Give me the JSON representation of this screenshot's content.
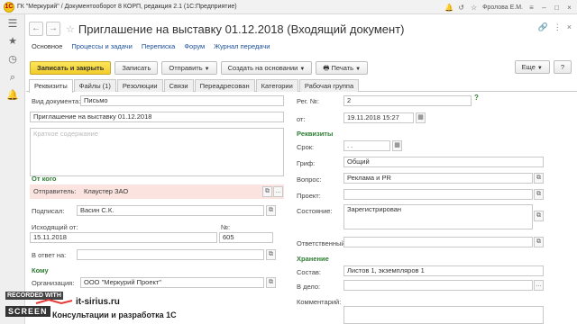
{
  "window": {
    "title": "ГК \"Меркурий\" / Документооборот 8 КОРП, редакция 2.1  (1С:Предприятие)",
    "user": "Фролова Е.М."
  },
  "form": {
    "title": "Приглашение на выставку 01.12.2018 (Входящий документ)"
  },
  "navlinks": {
    "main": "Основное",
    "processes": "Процессы и задачи",
    "correspondence": "Переписка",
    "forum": "Форум",
    "journal": "Журнал передачи"
  },
  "toolbar": {
    "save_close": "Записать и закрыть",
    "save": "Записать",
    "send": "Отправить",
    "create_based": "Создать на основании",
    "print": "Печать",
    "more": "Еще",
    "help": "?"
  },
  "tabs": [
    "Реквизиты",
    "Файлы (1)",
    "Резолюции",
    "Связи",
    "Переадресован",
    "Категории",
    "Рабочая группа"
  ],
  "left": {
    "doc_type_label": "Вид документа:",
    "doc_type": "Письмо",
    "title_label": "Заголовок:",
    "title": "Приглашение на выставку 01.12.2018",
    "summary_placeholder": "Краткое содержание",
    "from_section": "От кого",
    "sender_label": "Отправитель:",
    "sender": "Клаустер ЗАО",
    "signed_label": "Подписал:",
    "signed": "Васин С.К.",
    "outgoing_label": "Исходящий от:",
    "outgoing_date": "15.11.2018",
    "number_label": "№:",
    "number": "605",
    "reply_label": "В ответ на:",
    "to_section": "Кому",
    "org_label": "Организация:",
    "org": "ООО \"Меркурий Проект\""
  },
  "right": {
    "reg_label": "Рег. №:",
    "reg": "2",
    "from_label": "от:",
    "from_date": "19.11.2018 15:27",
    "props_section": "Реквизиты",
    "deadline_label": "Срок:",
    "deadline": ". .",
    "stamp_label": "Гриф:",
    "stamp": "Общий",
    "question_label": "Вопрос:",
    "question": "Реклама и PR",
    "project_label": "Проект:",
    "project": "",
    "state_label": "Состояние:",
    "state": "Зарегистрирован",
    "responsible_label": "Ответственный:",
    "responsible": "",
    "storage_section": "Хранение",
    "composition_label": "Состав:",
    "composition": "Листов 1, экземпляров 1",
    "file_label": "В дело:",
    "comment_label": "Комментарий:"
  },
  "overlay": {
    "rec1": "RECORDED WITH",
    "rec2": "SCREEN",
    "site": "it-sirius.ru",
    "tagline": "Консультации и разработка 1С"
  },
  "colors": {
    "accent_yellow": "#f2cc2c",
    "section_green": "#2e7d32",
    "link_blue": "#1a4f9c",
    "sender_highlight": "#fbe4df"
  }
}
